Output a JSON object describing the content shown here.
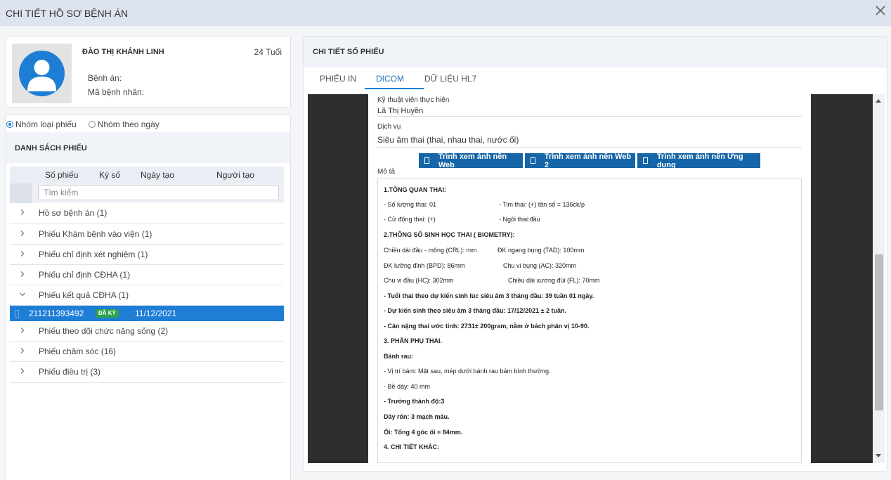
{
  "window": {
    "title": "CHI TIẾT HỒ SƠ BỆNH ÁN",
    "close_icon": "close-icon"
  },
  "patient": {
    "name": "ĐÀO THỊ KHÁNH LINH",
    "age": "24 Tuổi",
    "record_label": "Bệnh án:",
    "patient_code_label": "Mã bệnh nhân:",
    "avatar_icon": "user-avatar-icon"
  },
  "grouping": {
    "option_type": "Nhóm loại phiếu",
    "option_date": "Nhóm theo ngày",
    "selected": "Nhóm loại phiếu"
  },
  "list": {
    "title": "DANH SÁCH PHIẾU",
    "columns": [
      "Số phiếu",
      "Ký số",
      "Ngày tạo",
      "Người tạo"
    ],
    "search_placeholder": "Tìm kiếm",
    "groups": [
      {
        "label": "Hồ sơ bệnh án (1)",
        "expanded": false
      },
      {
        "label": "Phiếu Khám bệnh vào viện (1)",
        "expanded": false
      },
      {
        "label": "Phiếu chỉ định xét nghiệm (1)",
        "expanded": false
      },
      {
        "label": "Phiếu chỉ định CĐHA (1)",
        "expanded": false
      },
      {
        "label": "Phiếu kết quả CĐHA (1)",
        "expanded": true
      },
      {
        "label": "Phiếu theo dõi chức năng sống (2)",
        "expanded": false
      },
      {
        "label": "Phiếu chăm sóc (16)",
        "expanded": false
      },
      {
        "label": "Phiếu điều trị (3)",
        "expanded": false
      }
    ],
    "selected_row": {
      "number": "211211393492",
      "badge": "ĐÃ KÝ",
      "date": "11/12/2021"
    }
  },
  "detail": {
    "title": "CHI TIẾT SỐ PHIẾU",
    "tabs": [
      "PHIẾU IN",
      "DICOM",
      "DỮ LIỆU HL7"
    ],
    "active_tab": "DICOM",
    "technician_label": "Kỹ thuật viên thực hiện",
    "technician": "Lã Thị Huyền",
    "service_label": "Dịch vụ",
    "service": "Siêu âm thai (thai, nhau thai, nước ối)",
    "buttons": [
      "Trình xem ảnh nền Web",
      "Trình xem ảnh nền Web 2",
      "Trình xem ảnh nền Ứng dụng"
    ],
    "description_label": "Mô tả",
    "description": [
      {
        "text": "1.TỔNG QUAN THAI:",
        "bold": true
      },
      {
        "text": "- Số lượng thai: 01",
        "text2": "- Tim thai:   (+)  tần số = 136ck/p",
        "bold": false
      },
      {
        "text": "- Cử động thai: (+)",
        "text2": "- Ngôi thai:đầu",
        "bold": false
      },
      {
        "text": "2.THÔNG SỐ SINH HỌC THAI ( BIOMETRY):",
        "bold": true
      },
      {
        "text": "Chiều dài đầu - mông (CRL): mm",
        "text2": "ĐK ngang bụng (TAD): 100mm",
        "bold": false
      },
      {
        "text": "ĐK lưỡng đỉnh (BPD): 86mm",
        "text2": "Chu vi bụng (AC): 320mm",
        "bold": false
      },
      {
        "text": "Chu vi đầu (HC): 302mm",
        "text2": "Chiều dài xương đùi (FL): 70mm",
        "bold": false
      },
      {
        "text": "- Tuổi thai theo dự kiến sinh lúc siêu âm 3 tháng đầu: 39 tuần 01 ngày.",
        "bold": true
      },
      {
        "text": "- Dự kiến sinh theo siêu âm 3 tháng đầu: 17/12/2021 ± 2 tuần.",
        "bold": true
      },
      {
        "text": "- Cân nặng thai ước tính: 2731± 200gram, nằm ở bách phân vị 10-90.",
        "bold": true
      },
      {
        "text": "3. PHẦN PHỤ THAI.",
        "bold": true
      },
      {
        "text": "Bánh rau:",
        "bold": true
      },
      {
        "text": "- Vị trí bám: Mặt sau, mép dưới bánh rau bám bình thường.",
        "bold": false
      },
      {
        "text": "- Bề dày: 40 mm",
        "bold": false
      },
      {
        "text": "- Trưởng thành độ:3",
        "bold": true
      },
      {
        "text": "Dây rốn: 3 mạch máu.",
        "bold": true
      },
      {
        "text": "Ối: Tổng 4 góc ối = 84mm.",
        "bold": true
      },
      {
        "text": "4. CHI TIẾT KHÁC:",
        "bold": true
      }
    ]
  },
  "colors": {
    "accent": "#1e7ed6",
    "button": "#1565a8",
    "badge": "#2ba24c",
    "titlebar": "#dde3ef"
  }
}
